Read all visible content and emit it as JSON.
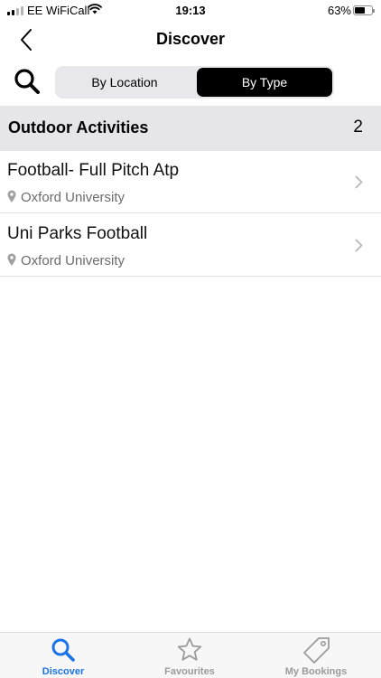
{
  "status_bar": {
    "carrier": "EE WiFiCall",
    "time": "19:13",
    "battery": "63%",
    "battery_level": 0.63
  },
  "nav": {
    "title": "Discover",
    "back_icon": "chevron-left-icon"
  },
  "filter": {
    "search_icon": "search-icon",
    "options": [
      "By Location",
      "By Type"
    ],
    "selected": "By Type"
  },
  "section": {
    "title": "Outdoor Activities",
    "count": "2"
  },
  "activities": [
    {
      "title": "Football- Full Pitch Atp",
      "location": "Oxford University"
    },
    {
      "title": "Uni Parks Football",
      "location": "Oxford University"
    }
  ],
  "tabs": [
    {
      "label": "Discover",
      "icon": "search-icon",
      "active": true
    },
    {
      "label": "Favourites",
      "icon": "star-icon",
      "active": false
    },
    {
      "label": "My Bookings",
      "icon": "tag-icon",
      "active": false
    }
  ],
  "colors": {
    "accent": "#1a73e8",
    "selected_segment": "#000000",
    "section_bg": "#e6e6e9"
  }
}
